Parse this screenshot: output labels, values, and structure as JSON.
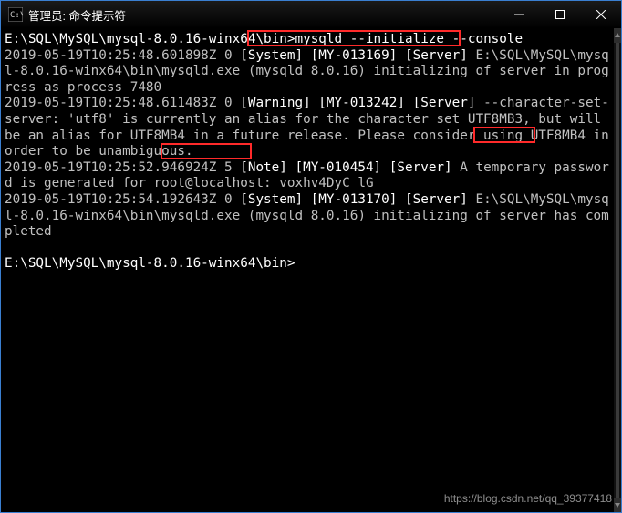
{
  "window": {
    "title": "管理员: 命令提示符"
  },
  "terminal": {
    "prompt_path": "E:\\SQL\\MySQL\\mysql-8.0.16-winx64\\bin>",
    "command": "mysqld --initialize --console",
    "lines": {
      "l1a": "2019-05-19T10:25:48.601898Z 0 ",
      "l1b": "[System] [MY-013169] [Server]",
      "l1c": " E:\\SQL\\MySQL\\mysql-8.0.16-winx64\\bin\\mysqld.exe (mysqld 8.0.16) initializing of server in progress as process 7480",
      "l2a": "2019-05-19T10:25:48.611483Z 0 ",
      "l2b": "[Warning] [MY-013242] [Server]",
      "l2c": " --character-set-server: 'utf8' is currently an alias for the character set UTF8MB3, but will be an alias for UTF8MB4 in a future release. Please consider using UTF8MB4 in order to be unambiguous.",
      "l3a": "2019-05-19T10:25:52.946924Z 5 ",
      "l3b": "[Note] [MY-010454] [Server]",
      "l3c": " A temporary ",
      "l3_pw_label": "password",
      "l3d": " is generated for root@localhost: ",
      "l3_password": "voxhv4DyC_lG",
      "l4a": "2019-05-19T10:25:54.192643Z 0 ",
      "l4b": "[System] [MY-013170] [Server]",
      "l4c": " E:\\SQL\\MySQL\\mysql-8.0.16-winx64\\bin\\mysqld.exe (mysqld 8.0.16) initializing of server has completed"
    },
    "prompt2": "E:\\SQL\\MySQL\\mysql-8.0.16-winx64\\bin>"
  },
  "watermark": "https://blog.csdn.net/qq_39377418"
}
